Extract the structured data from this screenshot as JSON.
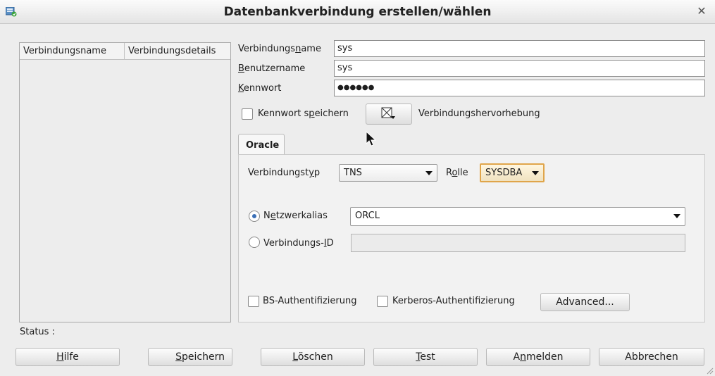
{
  "window": {
    "title": "Datenbankverbindung erstellen/wählen"
  },
  "connection_list": {
    "columns": [
      "Verbindungsname",
      "Verbindungsdetails"
    ]
  },
  "form": {
    "connection_name": {
      "label_pre": "Verbindungs",
      "label_mnemonic": "n",
      "label_post": "ame",
      "value": "sys"
    },
    "username": {
      "label_mnemonic": "B",
      "label_post": "enutzername",
      "value": "sys"
    },
    "password": {
      "label_mnemonic": "K",
      "label_post": "ennwort",
      "value": "●●●●●●"
    },
    "save_password": {
      "label_pre": "Kennwort s",
      "label_mnemonic": "p",
      "label_post": "eichern",
      "checked": false
    },
    "highlight_label": "Verbindungshervorhebung"
  },
  "tabs": [
    {
      "label": "Oracle",
      "active": true
    }
  ],
  "oracle": {
    "connection_type": {
      "label_pre": "Verbindungst",
      "label_mnemonic": "y",
      "label_post": "p",
      "value": "TNS"
    },
    "role": {
      "label_pre": "R",
      "label_mnemonic": "o",
      "label_post": "lle",
      "value": "SYSDBA"
    },
    "network_alias": {
      "label_pre": "N",
      "label_mnemonic": "e",
      "label_post": "tzwerkalias",
      "value": "ORCL",
      "selected": true
    },
    "connection_id": {
      "label_pre": "Verbindungs-",
      "label_mnemonic": "I",
      "label_post": "D",
      "value": "",
      "selected": false
    },
    "os_auth": {
      "label": "BS-Authentifizierung",
      "checked": false
    },
    "kerberos_auth": {
      "label": "Kerberos-Authentifizierung",
      "checked": false
    },
    "advanced_label": "Advanced..."
  },
  "status": {
    "label": "Status :"
  },
  "buttons": {
    "help": {
      "mnemonic": "H",
      "rest": "ilfe"
    },
    "save": {
      "mnemonic": "S",
      "rest": "peichern"
    },
    "delete": {
      "mnemonic": "L",
      "rest": "öschen"
    },
    "test": {
      "mnemonic": "T",
      "rest": "est"
    },
    "connect": {
      "pre": "A",
      "mnemonic": "n",
      "rest": "melden"
    },
    "cancel": {
      "label": "Abbrechen"
    }
  }
}
